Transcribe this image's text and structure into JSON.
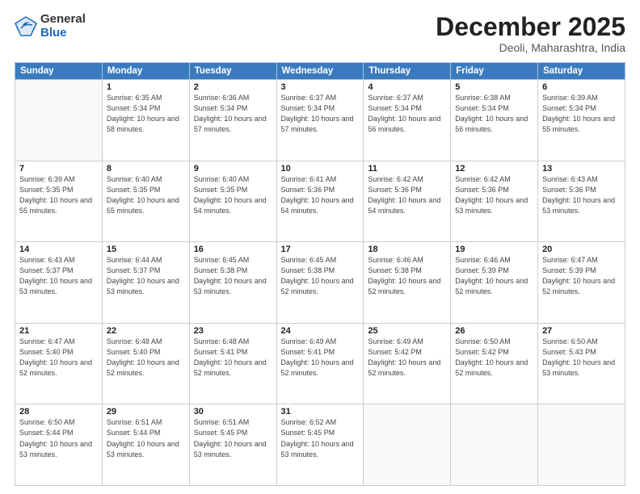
{
  "logo": {
    "general": "General",
    "blue": "Blue"
  },
  "header": {
    "month": "December 2025",
    "location": "Deoli, Maharashtra, India"
  },
  "days_of_week": [
    "Sunday",
    "Monday",
    "Tuesday",
    "Wednesday",
    "Thursday",
    "Friday",
    "Saturday"
  ],
  "weeks": [
    [
      {
        "day": "",
        "info": ""
      },
      {
        "day": "1",
        "info": "Sunrise: 6:35 AM\nSunset: 5:34 PM\nDaylight: 10 hours\nand 58 minutes."
      },
      {
        "day": "2",
        "info": "Sunrise: 6:36 AM\nSunset: 5:34 PM\nDaylight: 10 hours\nand 57 minutes."
      },
      {
        "day": "3",
        "info": "Sunrise: 6:37 AM\nSunset: 5:34 PM\nDaylight: 10 hours\nand 57 minutes."
      },
      {
        "day": "4",
        "info": "Sunrise: 6:37 AM\nSunset: 5:34 PM\nDaylight: 10 hours\nand 56 minutes."
      },
      {
        "day": "5",
        "info": "Sunrise: 6:38 AM\nSunset: 5:34 PM\nDaylight: 10 hours\nand 56 minutes."
      },
      {
        "day": "6",
        "info": "Sunrise: 6:39 AM\nSunset: 5:34 PM\nDaylight: 10 hours\nand 55 minutes."
      }
    ],
    [
      {
        "day": "7",
        "info": "Sunrise: 6:39 AM\nSunset: 5:35 PM\nDaylight: 10 hours\nand 55 minutes."
      },
      {
        "day": "8",
        "info": "Sunrise: 6:40 AM\nSunset: 5:35 PM\nDaylight: 10 hours\nand 55 minutes."
      },
      {
        "day": "9",
        "info": "Sunrise: 6:40 AM\nSunset: 5:35 PM\nDaylight: 10 hours\nand 54 minutes."
      },
      {
        "day": "10",
        "info": "Sunrise: 6:41 AM\nSunset: 5:36 PM\nDaylight: 10 hours\nand 54 minutes."
      },
      {
        "day": "11",
        "info": "Sunrise: 6:42 AM\nSunset: 5:36 PM\nDaylight: 10 hours\nand 54 minutes."
      },
      {
        "day": "12",
        "info": "Sunrise: 6:42 AM\nSunset: 5:36 PM\nDaylight: 10 hours\nand 53 minutes."
      },
      {
        "day": "13",
        "info": "Sunrise: 6:43 AM\nSunset: 5:36 PM\nDaylight: 10 hours\nand 53 minutes."
      }
    ],
    [
      {
        "day": "14",
        "info": "Sunrise: 6:43 AM\nSunset: 5:37 PM\nDaylight: 10 hours\nand 53 minutes."
      },
      {
        "day": "15",
        "info": "Sunrise: 6:44 AM\nSunset: 5:37 PM\nDaylight: 10 hours\nand 53 minutes."
      },
      {
        "day": "16",
        "info": "Sunrise: 6:45 AM\nSunset: 5:38 PM\nDaylight: 10 hours\nand 53 minutes."
      },
      {
        "day": "17",
        "info": "Sunrise: 6:45 AM\nSunset: 5:38 PM\nDaylight: 10 hours\nand 52 minutes."
      },
      {
        "day": "18",
        "info": "Sunrise: 6:46 AM\nSunset: 5:38 PM\nDaylight: 10 hours\nand 52 minutes."
      },
      {
        "day": "19",
        "info": "Sunrise: 6:46 AM\nSunset: 5:39 PM\nDaylight: 10 hours\nand 52 minutes."
      },
      {
        "day": "20",
        "info": "Sunrise: 6:47 AM\nSunset: 5:39 PM\nDaylight: 10 hours\nand 52 minutes."
      }
    ],
    [
      {
        "day": "21",
        "info": "Sunrise: 6:47 AM\nSunset: 5:40 PM\nDaylight: 10 hours\nand 52 minutes."
      },
      {
        "day": "22",
        "info": "Sunrise: 6:48 AM\nSunset: 5:40 PM\nDaylight: 10 hours\nand 52 minutes."
      },
      {
        "day": "23",
        "info": "Sunrise: 6:48 AM\nSunset: 5:41 PM\nDaylight: 10 hours\nand 52 minutes."
      },
      {
        "day": "24",
        "info": "Sunrise: 6:49 AM\nSunset: 5:41 PM\nDaylight: 10 hours\nand 52 minutes."
      },
      {
        "day": "25",
        "info": "Sunrise: 6:49 AM\nSunset: 5:42 PM\nDaylight: 10 hours\nand 52 minutes."
      },
      {
        "day": "26",
        "info": "Sunrise: 6:50 AM\nSunset: 5:42 PM\nDaylight: 10 hours\nand 52 minutes."
      },
      {
        "day": "27",
        "info": "Sunrise: 6:50 AM\nSunset: 5:43 PM\nDaylight: 10 hours\nand 53 minutes."
      }
    ],
    [
      {
        "day": "28",
        "info": "Sunrise: 6:50 AM\nSunset: 5:44 PM\nDaylight: 10 hours\nand 53 minutes."
      },
      {
        "day": "29",
        "info": "Sunrise: 6:51 AM\nSunset: 5:44 PM\nDaylight: 10 hours\nand 53 minutes."
      },
      {
        "day": "30",
        "info": "Sunrise: 6:51 AM\nSunset: 5:45 PM\nDaylight: 10 hours\nand 53 minutes."
      },
      {
        "day": "31",
        "info": "Sunrise: 6:52 AM\nSunset: 5:45 PM\nDaylight: 10 hours\nand 53 minutes."
      },
      {
        "day": "",
        "info": ""
      },
      {
        "day": "",
        "info": ""
      },
      {
        "day": "",
        "info": ""
      }
    ]
  ]
}
